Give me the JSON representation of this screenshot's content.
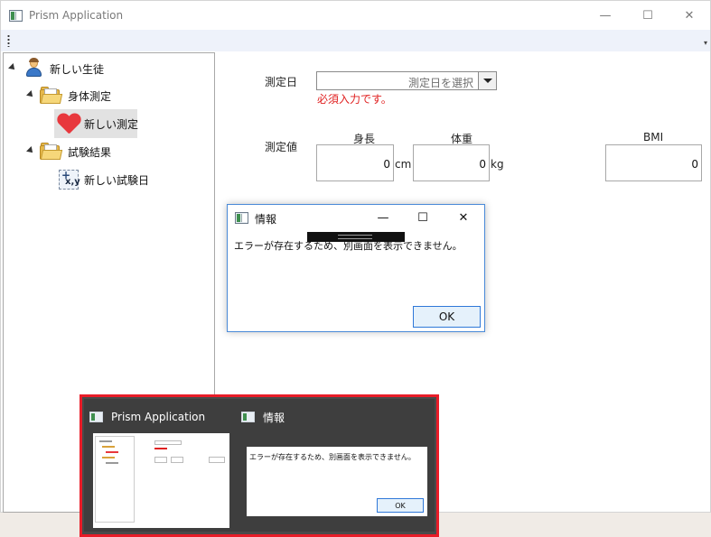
{
  "window": {
    "title": "Prism Application",
    "minimize_glyph": "—",
    "maximize_glyph": "☐",
    "close_glyph": "✕"
  },
  "toolbar": {
    "overflow_glyph": "▾"
  },
  "tree": {
    "root": {
      "label": "新しい生徒",
      "icon": "user-icon"
    },
    "children": [
      {
        "label": "身体測定",
        "icon": "folder-icon",
        "children": [
          {
            "label": "新しい測定",
            "icon": "heart-icon",
            "selected": true
          }
        ]
      },
      {
        "label": "試験結果",
        "icon": "folder-icon",
        "children": [
          {
            "label": "新しい試験日",
            "icon": "xy-chart-icon"
          }
        ]
      }
    ]
  },
  "form": {
    "date_label": "測定日",
    "date_placeholder": "測定日を選択",
    "date_error": "必須入力です。",
    "values_label": "測定値",
    "height_header": "身長",
    "height_value": "0",
    "height_unit": "cm",
    "weight_header": "体重",
    "weight_value": "0",
    "weight_unit": "kg",
    "bmi_header": "BMI",
    "bmi_value": "0"
  },
  "dialog": {
    "title": "情報",
    "message": "エラーが存在するため、別画面を表示できません。",
    "ok_label": "OK",
    "minimize_glyph": "—",
    "maximize_glyph": "☐",
    "close_glyph": "✕"
  },
  "taskbar_preview": {
    "items": [
      {
        "title": "Prism Application"
      },
      {
        "title": "情報",
        "message": "エラーが存在するため、別画面を表示できません。",
        "ok_label": "OK"
      }
    ],
    "highlight_color": "#e81c28"
  },
  "colors": {
    "error": "#e02020",
    "dialog_border": "#4a8ad8",
    "toolbar_bg": "#eef2fa"
  }
}
